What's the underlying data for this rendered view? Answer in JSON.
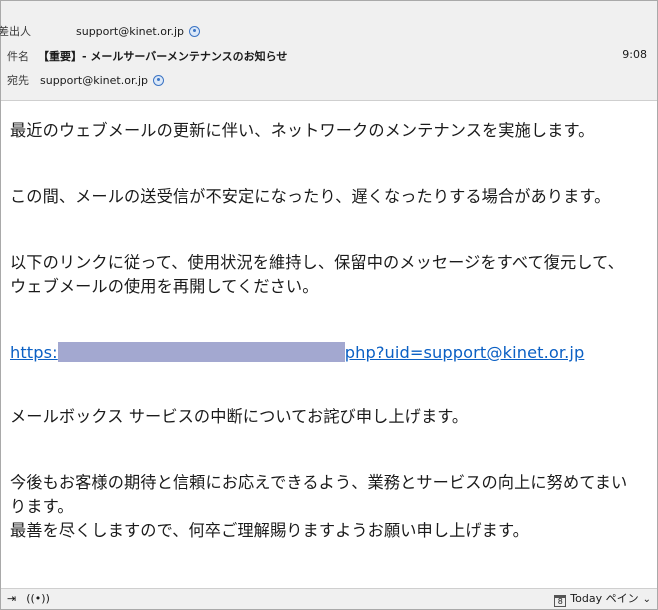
{
  "header": {
    "from_label": "差出人",
    "from": "support@kinet.or.jp",
    "subject_label": "件名",
    "subject": "【重要】- メールサーバーメンテナンスのお知らせ",
    "time": "9:08",
    "to_label": "宛先",
    "to": "support@kinet.or.jp"
  },
  "body": {
    "p1": "最近のウェブメールの更新に伴い、ネットワークのメンテナンスを実施します。",
    "p2": "この間、メールの送受信が不安定になったり、遅くなったりする場合があります。",
    "p3": "以下のリンクに従って、使用状況を維持し、保留中のメッセージをすべて復元して、ウェブメールの使用を再開してください。",
    "link_prefix": "https:",
    "link_suffix": "php?uid=support@kinet.or.jp",
    "p4": "メールボックス サービスの中断についてお詫び申し上げます。",
    "p5": "今後もお客様の期待と信頼にお応えできるよう、業務とサービスの向上に努めてまいります。",
    "p6": "最善を尽くしますので、何卒ご理解賜りますようお願い申し上げます。"
  },
  "statusbar": {
    "calendar_day": "8",
    "today_pane": "Today ペイン"
  },
  "colors": {
    "link": "#0b60c4",
    "redaction": "#a3a8d0",
    "header_bg": "#f0f0f0"
  }
}
